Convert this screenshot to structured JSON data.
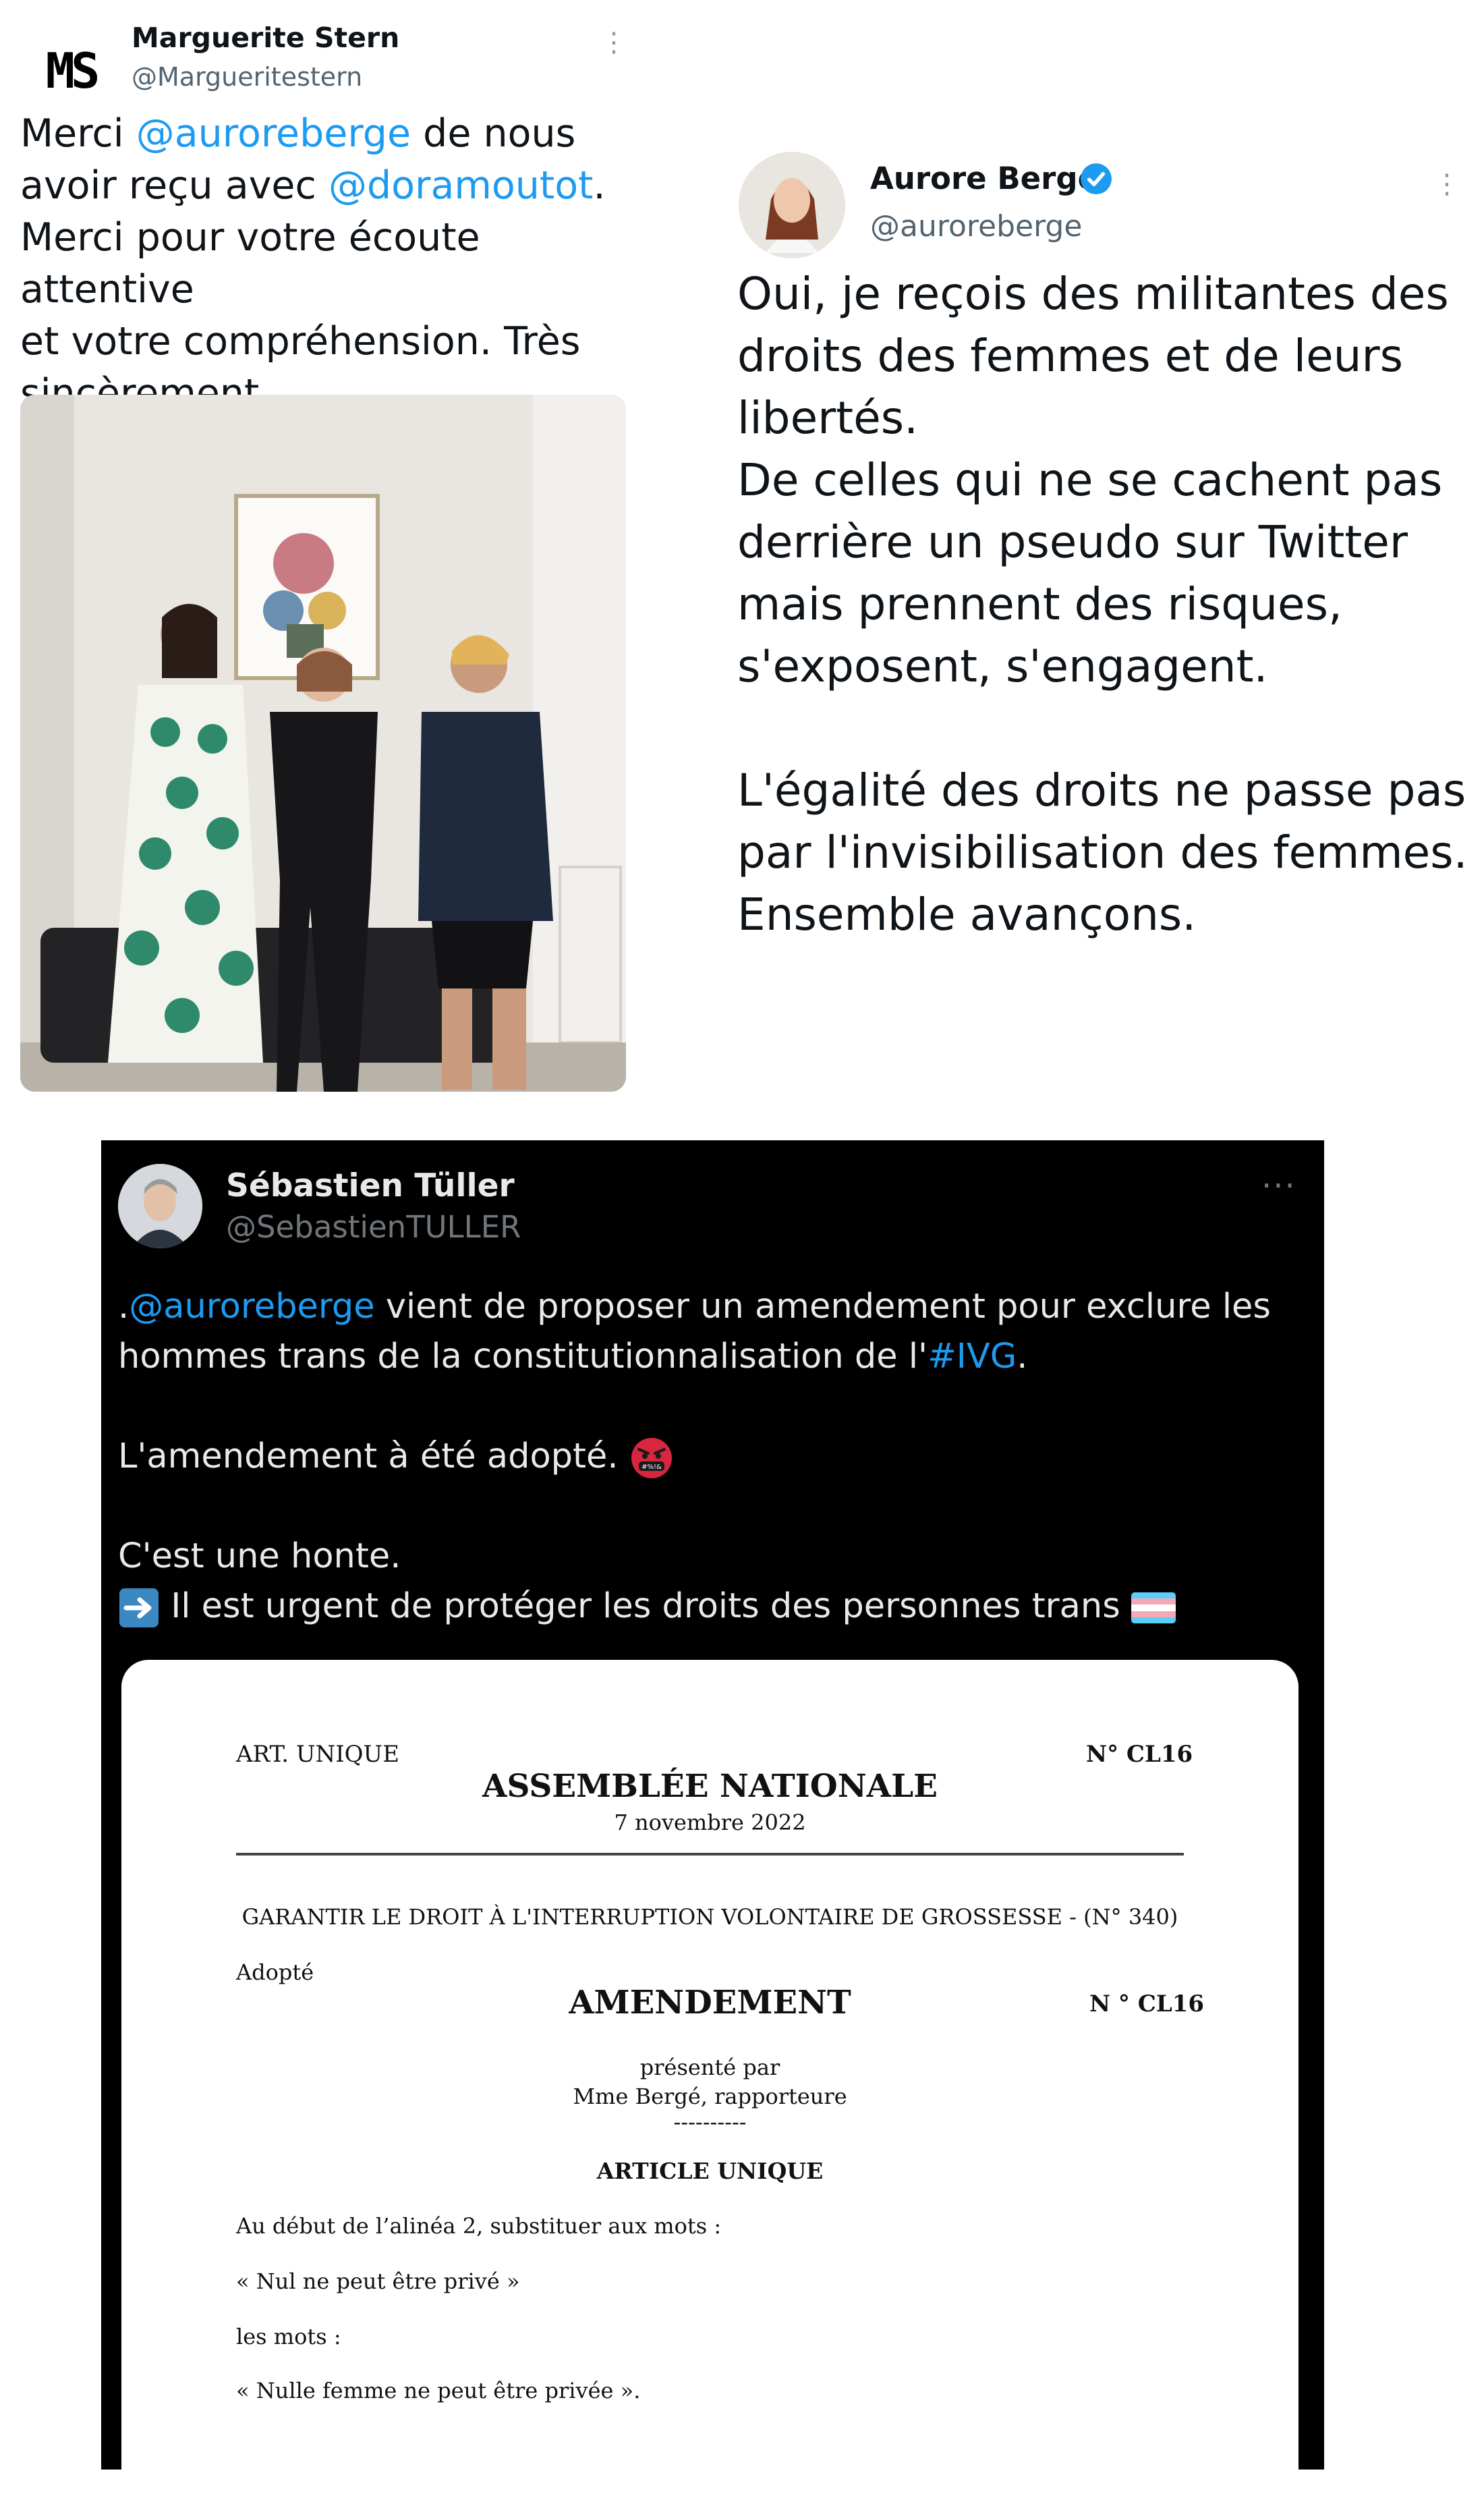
{
  "tweet1": {
    "avatar_text": "MS",
    "name": "Marguerite Stern",
    "handle": "@Margueritestern",
    "menu_icon": "⋮",
    "text": {
      "p1": "Merci ",
      "mention1": "@auroreberge",
      "p2": " de nous",
      "p3": "avoir reçu avec ",
      "mention2": "@doramoutot",
      "p4": ".",
      "line3": "Merci pour votre écoute attentive",
      "line4": "et votre compréhension. Très",
      "line5": "sincèrement."
    }
  },
  "tweet2": {
    "name": "Aurore Bergé",
    "handle": "@auroreberge",
    "menu_icon": "⋮",
    "verified_color": "#1d9bf0",
    "lines": [
      "Oui, je reçois des militantes des",
      "droits des femmes et de leurs",
      "libertés.",
      "De celles qui ne se cachent pas",
      "derrière un pseudo sur Twitter",
      "mais prennent des risques,",
      "s'exposent, s'engagent.",
      "",
      "L'égalité des droits ne passe pas",
      "par l'invisibilisation des femmes.",
      "Ensemble avançons."
    ]
  },
  "tweet3": {
    "name": "Sébastien Tüller",
    "handle": "@SebastienTULLER",
    "menu_icon": "···",
    "line1_prefix": ".",
    "line1_mention": "@auroreberge",
    "line1_rest": " vient de proposer un amendement pour exclure les",
    "line2_text": "hommes trans de la constitutionnalisation de l'",
    "line2_hashtag": "#IVG",
    "line2_end": ".",
    "line3": "L'amendement à été adopté.",
    "line4": "C'est une honte.",
    "line5": "Il est urgent de protéger les droits des personnes trans",
    "angry_emoji_label": "#%!&",
    "document": {
      "art": "ART. UNIQUE",
      "number_top": "N° CL16",
      "assembly": "ASSEMBLÉE NATIONALE",
      "date": "7 novembre 2022",
      "subject": "GARANTIR LE DROIT À L'INTERRUPTION VOLONTAIRE DE GROSSESSE - (N° 340)",
      "status": "Adopté",
      "heading": "AMENDEMENT",
      "number": "N ° CL16",
      "presented_by": "présenté par",
      "author": "Mme Bergé, rapporteure",
      "dashes": "----------",
      "article": "ARTICLE UNIQUE",
      "body1": "Au début de l’alinéa 2, substituer aux mots :",
      "body2": "« Nul ne peut être privé »",
      "body3": "les mots :",
      "body4": "« Nulle femme ne peut être privée »."
    }
  }
}
